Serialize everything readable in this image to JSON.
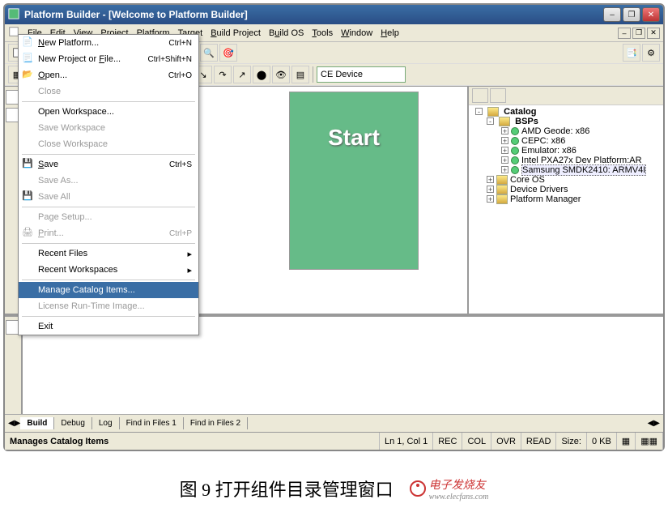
{
  "window": {
    "title": "Platform Builder - [Welcome to Platform Builder]"
  },
  "menubar": {
    "items": [
      "File",
      "Edit",
      "View",
      "Project",
      "Platform",
      "Target",
      "Build Project",
      "Build OS",
      "Tools",
      "Window",
      "Help"
    ]
  },
  "file_menu": {
    "items": [
      {
        "label": "New Platform...",
        "accel": "Ctrl+N",
        "icon": "new-platform"
      },
      {
        "label": "New Project or File...",
        "accel": "Ctrl+Shift+N",
        "icon": "new-file"
      },
      {
        "label": "Open...",
        "accel": "Ctrl+O",
        "icon": "open"
      },
      {
        "label": "Close",
        "disabled": true
      },
      {
        "sep": true
      },
      {
        "label": "Open Workspace..."
      },
      {
        "label": "Save Workspace",
        "disabled": true
      },
      {
        "label": "Close Workspace",
        "disabled": true
      },
      {
        "sep": true
      },
      {
        "label": "Save",
        "accel": "Ctrl+S",
        "icon": "save"
      },
      {
        "label": "Save As...",
        "disabled": true
      },
      {
        "label": "Save All",
        "icon": "save-all",
        "disabled": true
      },
      {
        "sep": true
      },
      {
        "label": "Page Setup...",
        "disabled": true
      },
      {
        "label": "Print...",
        "accel": "Ctrl+P",
        "icon": "print",
        "disabled": true
      },
      {
        "sep": true
      },
      {
        "label": "Recent Files",
        "submenu": true
      },
      {
        "label": "Recent Workspaces",
        "submenu": true
      },
      {
        "sep": true
      },
      {
        "label": "Manage Catalog Items...",
        "selected": true
      },
      {
        "label": "License Run-Time Image...",
        "disabled": true
      },
      {
        "sep": true
      },
      {
        "label": "Exit"
      }
    ]
  },
  "device_combo": "CE Device",
  "editor_placeholder": "Start",
  "catalog": {
    "root": "Catalog",
    "bsps_label": "BSPs",
    "bsps": [
      "AMD Geode: x86",
      "CEPC: x86",
      "Emulator: x86",
      "Intel PXA27x Dev Platform:AR",
      "Samsung SMDK2410: ARMV4I"
    ],
    "others": [
      "Core OS",
      "Device Drivers",
      "Platform Manager"
    ]
  },
  "output_tabs": [
    "Build",
    "Debug",
    "Log",
    "Find in Files 1",
    "Find in Files 2"
  ],
  "statusbar": {
    "help": "Manages Catalog Items",
    "pos": "Ln 1, Col 1",
    "rec": "REC",
    "col": "COL",
    "ovr": "OVR",
    "read": "READ",
    "size_label": "Size:",
    "size_val": "0 KB"
  },
  "caption": "图 9  打开组件目录管理窗口",
  "elecfans": {
    "brand": "电子发烧友",
    "url": "www.elecfans.com"
  }
}
